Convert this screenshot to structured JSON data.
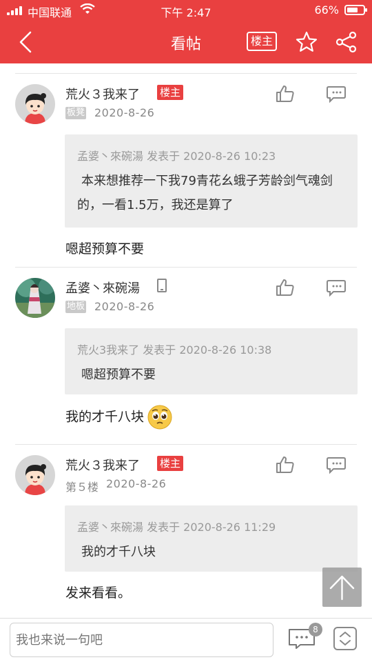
{
  "status_bar": {
    "carrier": "中国联通",
    "time": "下午 2:47",
    "battery": "66%",
    "battery_level": 0.66
  },
  "nav": {
    "title": "看帖",
    "owner_button": "楼主"
  },
  "posts": [
    {
      "author": "荒火３我来了",
      "owner_tag": "楼主",
      "floor": "板凳",
      "date": "2020-8-26",
      "quote_header": "孟婆丶來碗湯 发表于 2020-8-26 10:23",
      "quote_body": "本来想推荐一下我79青花幺蛾子芳龄剑气魂剑的，一看1.5万，我还是算了",
      "body": "嗯超预算不要"
    },
    {
      "author": "孟婆丶來碗湯",
      "floor": "地板",
      "date": "2020-8-26",
      "quote_header": "荒火3我来了 发表于 2020-8-26 10:38",
      "quote_body": "嗯超预算不要",
      "body": "我的才千八块"
    },
    {
      "author": "荒火３我来了",
      "owner_tag": "楼主",
      "floor": "第５楼",
      "date": "2020-8-26",
      "quote_header": "孟婆丶來碗湯 发表于 2020-8-26 11:29",
      "quote_body": "我的才千八块",
      "body": "发来看看。"
    }
  ],
  "bottom": {
    "input_placeholder": "我也来说一句吧",
    "comment_count": "8"
  },
  "colors": {
    "brand": "#e94040",
    "quote_bg": "#ededed",
    "muted": "#888888"
  }
}
